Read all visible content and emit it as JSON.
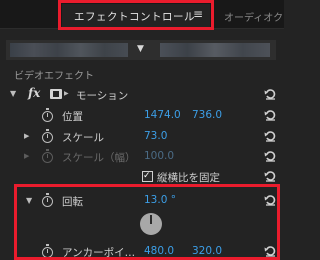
{
  "tabs": {
    "active_label": "エフェクトコントロール",
    "menu_glyph": "≡",
    "other_label": "オーディオク"
  },
  "clip_bar": {
    "dropdown_arrow": "▼"
  },
  "section": {
    "title": "ビデオエフェクト"
  },
  "motion": {
    "fx_label": "fx",
    "name": "モーション",
    "properties": {
      "position": {
        "label": "位置",
        "x": "1474.0",
        "y": "736.0"
      },
      "scale": {
        "label": "スケール",
        "value": "73.0"
      },
      "scale_width": {
        "label": "スケール（幅）",
        "value": "100.0"
      },
      "uniform_scale": {
        "label": "縦横比を固定",
        "checked": true
      },
      "rotation": {
        "label": "回転",
        "value": "13.0 °"
      },
      "anchor": {
        "label": "アンカーポイ…",
        "x": "480.0",
        "y": "320.0"
      }
    }
  },
  "glyphs": {
    "expand_down": "▼",
    "expand_right": "▶",
    "checkmark": "✓"
  }
}
